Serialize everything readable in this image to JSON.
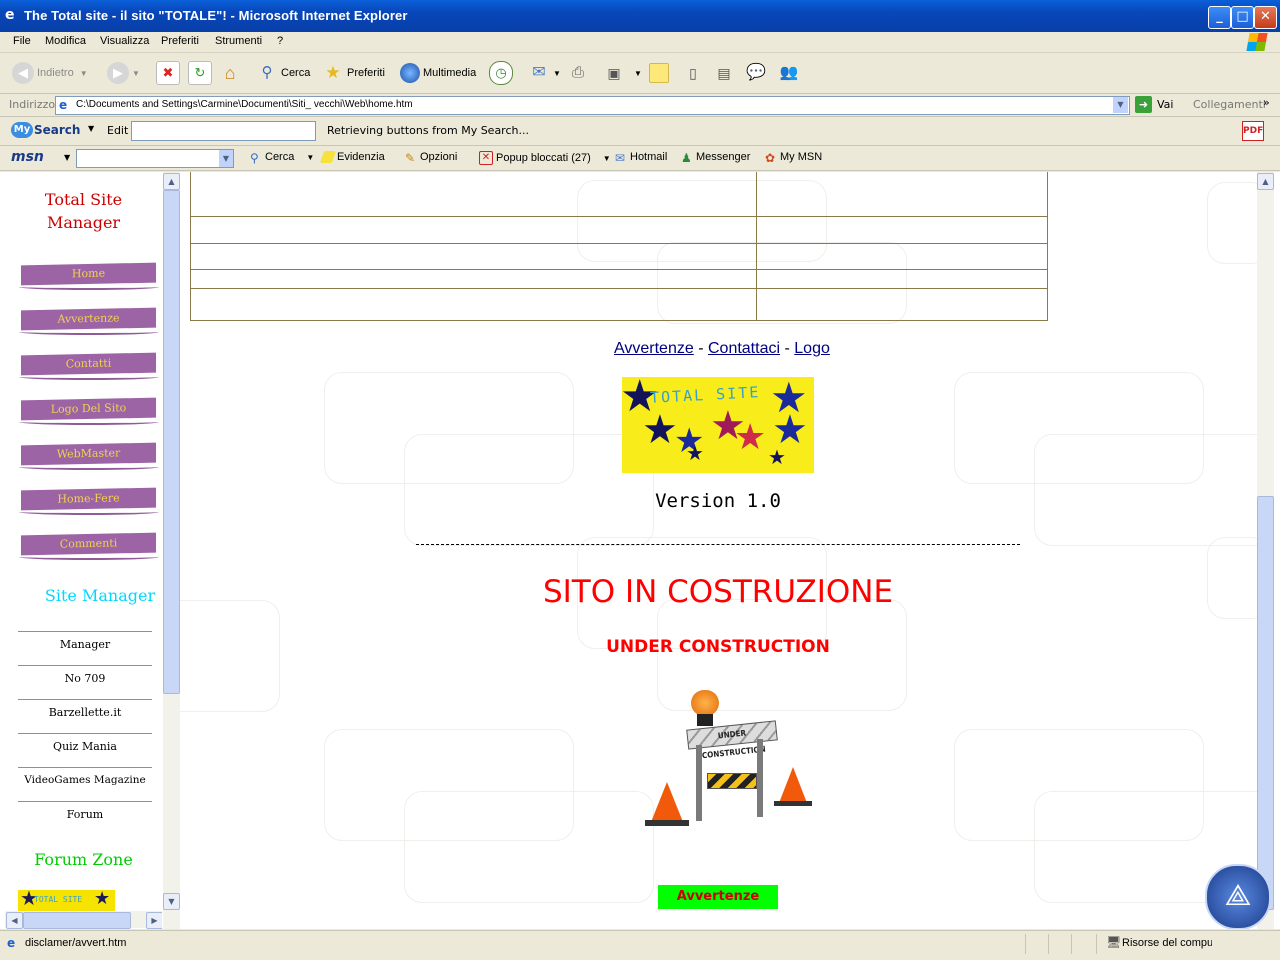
{
  "window": {
    "title": "The Total site - il sito \"TOTALE\"! - Microsoft Internet Explorer",
    "minimize": "_",
    "maximize": "□",
    "close": "✕"
  },
  "menu": [
    "File",
    "Modifica",
    "Visualizza",
    "Preferiti",
    "Strumenti",
    "?"
  ],
  "toolbar": {
    "back": "Indietro",
    "search": "Cerca",
    "favorites": "Preferiti",
    "media": "Multimedia"
  },
  "address": {
    "label": "Indirizzo",
    "value": "C:\\Documents and Settings\\Carmine\\Documenti\\Siti_ vecchi\\Web\\home.htm",
    "go": "Vai",
    "links": "Collegamenti"
  },
  "mysearch": {
    "logo_my": "My",
    "logo_search": "Search",
    "edit_label": "Edit",
    "status": "Retrieving buttons from My Search..."
  },
  "msn": {
    "logo": "msn",
    "search": "Cerca",
    "highlight": "Evidenzia",
    "options": "Opzioni",
    "popup": "Popup bloccati (27)",
    "hotmail": "Hotmail",
    "messenger": "Messenger",
    "mymsn": "My MSN"
  },
  "sidebar": {
    "title": "Total Site Manager",
    "nav": [
      "Home",
      "Avvertenze",
      "Contatti",
      "Logo Del Sito",
      "WebMaster",
      "Home-Fere",
      "Commenti"
    ],
    "site_manager_title": "Site Manager",
    "site_links": [
      "Manager",
      "No 709",
      "Barzellette.it",
      "Quiz Mania",
      "VideoGames Magazine",
      "Forum"
    ],
    "forum_title": "Forum Zone",
    "mini_logo_text": "TOTAL SITE"
  },
  "main": {
    "links": [
      "Avvertenze",
      "Contattaci",
      "Logo"
    ],
    "separator": "-",
    "logo_text": "TOTAL SITE",
    "version": "Version 1.0",
    "heading": "SITO IN COSTRUZIONE",
    "subheading": "UNDER CONSTRUCTION",
    "sign_text": "UNDER CONSTRUCTION",
    "button": "Avvertenze"
  },
  "status": {
    "url": "disclamer/avvert.htm",
    "zone": "Risorse del computer"
  },
  "colors": {
    "nav_bg": "#9c64a5",
    "nav_text": "#f0d34a",
    "sidebar_title": "#cc0000",
    "site_manager": "#00d8ff",
    "forum_zone": "#00cc00",
    "heading": "#ff0000",
    "link": "#000080",
    "button_bg": "#00ff00"
  }
}
